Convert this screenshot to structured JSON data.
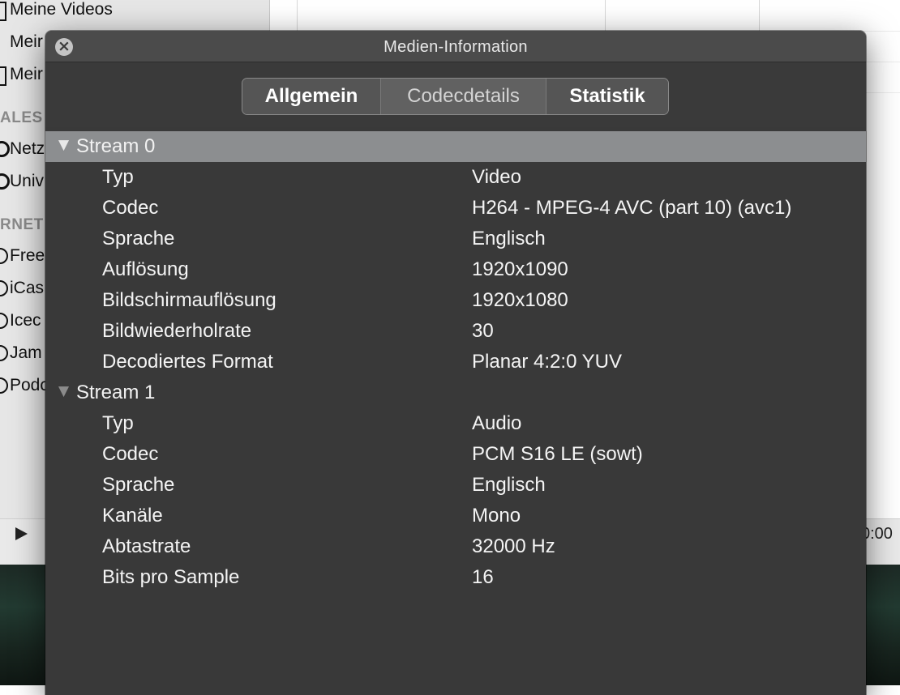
{
  "background": {
    "sidebar": {
      "items": [
        {
          "label": "Meine Videos",
          "icon": "video-library-icon"
        },
        {
          "label": "Meir",
          "icon": "music-library-icon"
        },
        {
          "label": "Meir",
          "icon": "pictures-library-icon"
        }
      ],
      "section_local": "ALES",
      "local_items": [
        {
          "label": "Netz",
          "icon": "network-icon"
        },
        {
          "label": "Univ",
          "icon": "upnp-icon"
        }
      ],
      "section_internet": "RNET",
      "internet_items": [
        {
          "label": "Free",
          "icon": "service-icon"
        },
        {
          "label": "iCas",
          "icon": "service-icon"
        },
        {
          "label": "Icec",
          "icon": "service-icon"
        },
        {
          "label": "Jam",
          "icon": "service-icon"
        },
        {
          "label": "Podc",
          "icon": "service-icon"
        }
      ]
    },
    "controls": {
      "play_icon": "play-icon",
      "time": "0:00"
    }
  },
  "dialog": {
    "title": "Medien-Information",
    "close_icon": "close-icon",
    "tabs": [
      {
        "label": "Allgemein",
        "active": false
      },
      {
        "label": "Codecdetails",
        "active": true
      },
      {
        "label": "Statistik",
        "active": false
      }
    ],
    "streams": [
      {
        "name": "Stream 0",
        "expanded": true,
        "selected": true,
        "properties": [
          {
            "key": "Typ",
            "value": "Video"
          },
          {
            "key": "Codec",
            "value": "H264 - MPEG-4 AVC (part 10) (avc1)"
          },
          {
            "key": "Sprache",
            "value": "Englisch"
          },
          {
            "key": "Auflösung",
            "value": "1920x1090"
          },
          {
            "key": "Bildschirmauflösung",
            "value": "1920x1080"
          },
          {
            "key": "Bildwiederholrate",
            "value": "30"
          },
          {
            "key": "Decodiertes Format",
            "value": "Planar 4:2:0 YUV"
          }
        ]
      },
      {
        "name": "Stream 1",
        "expanded": true,
        "selected": false,
        "properties": [
          {
            "key": "Typ",
            "value": "Audio"
          },
          {
            "key": "Codec",
            "value": "PCM S16 LE (sowt)"
          },
          {
            "key": "Sprache",
            "value": "Englisch"
          },
          {
            "key": "Kanäle",
            "value": "Mono"
          },
          {
            "key": "Abtastrate",
            "value": "32000 Hz"
          },
          {
            "key": "Bits pro Sample",
            "value": "16"
          }
        ]
      }
    ]
  },
  "colors": {
    "panel_bg": "#393939",
    "titlebar_bg": "#4b4b4b",
    "selected_row": "#8c8e90",
    "text": "#f4f4f4"
  }
}
